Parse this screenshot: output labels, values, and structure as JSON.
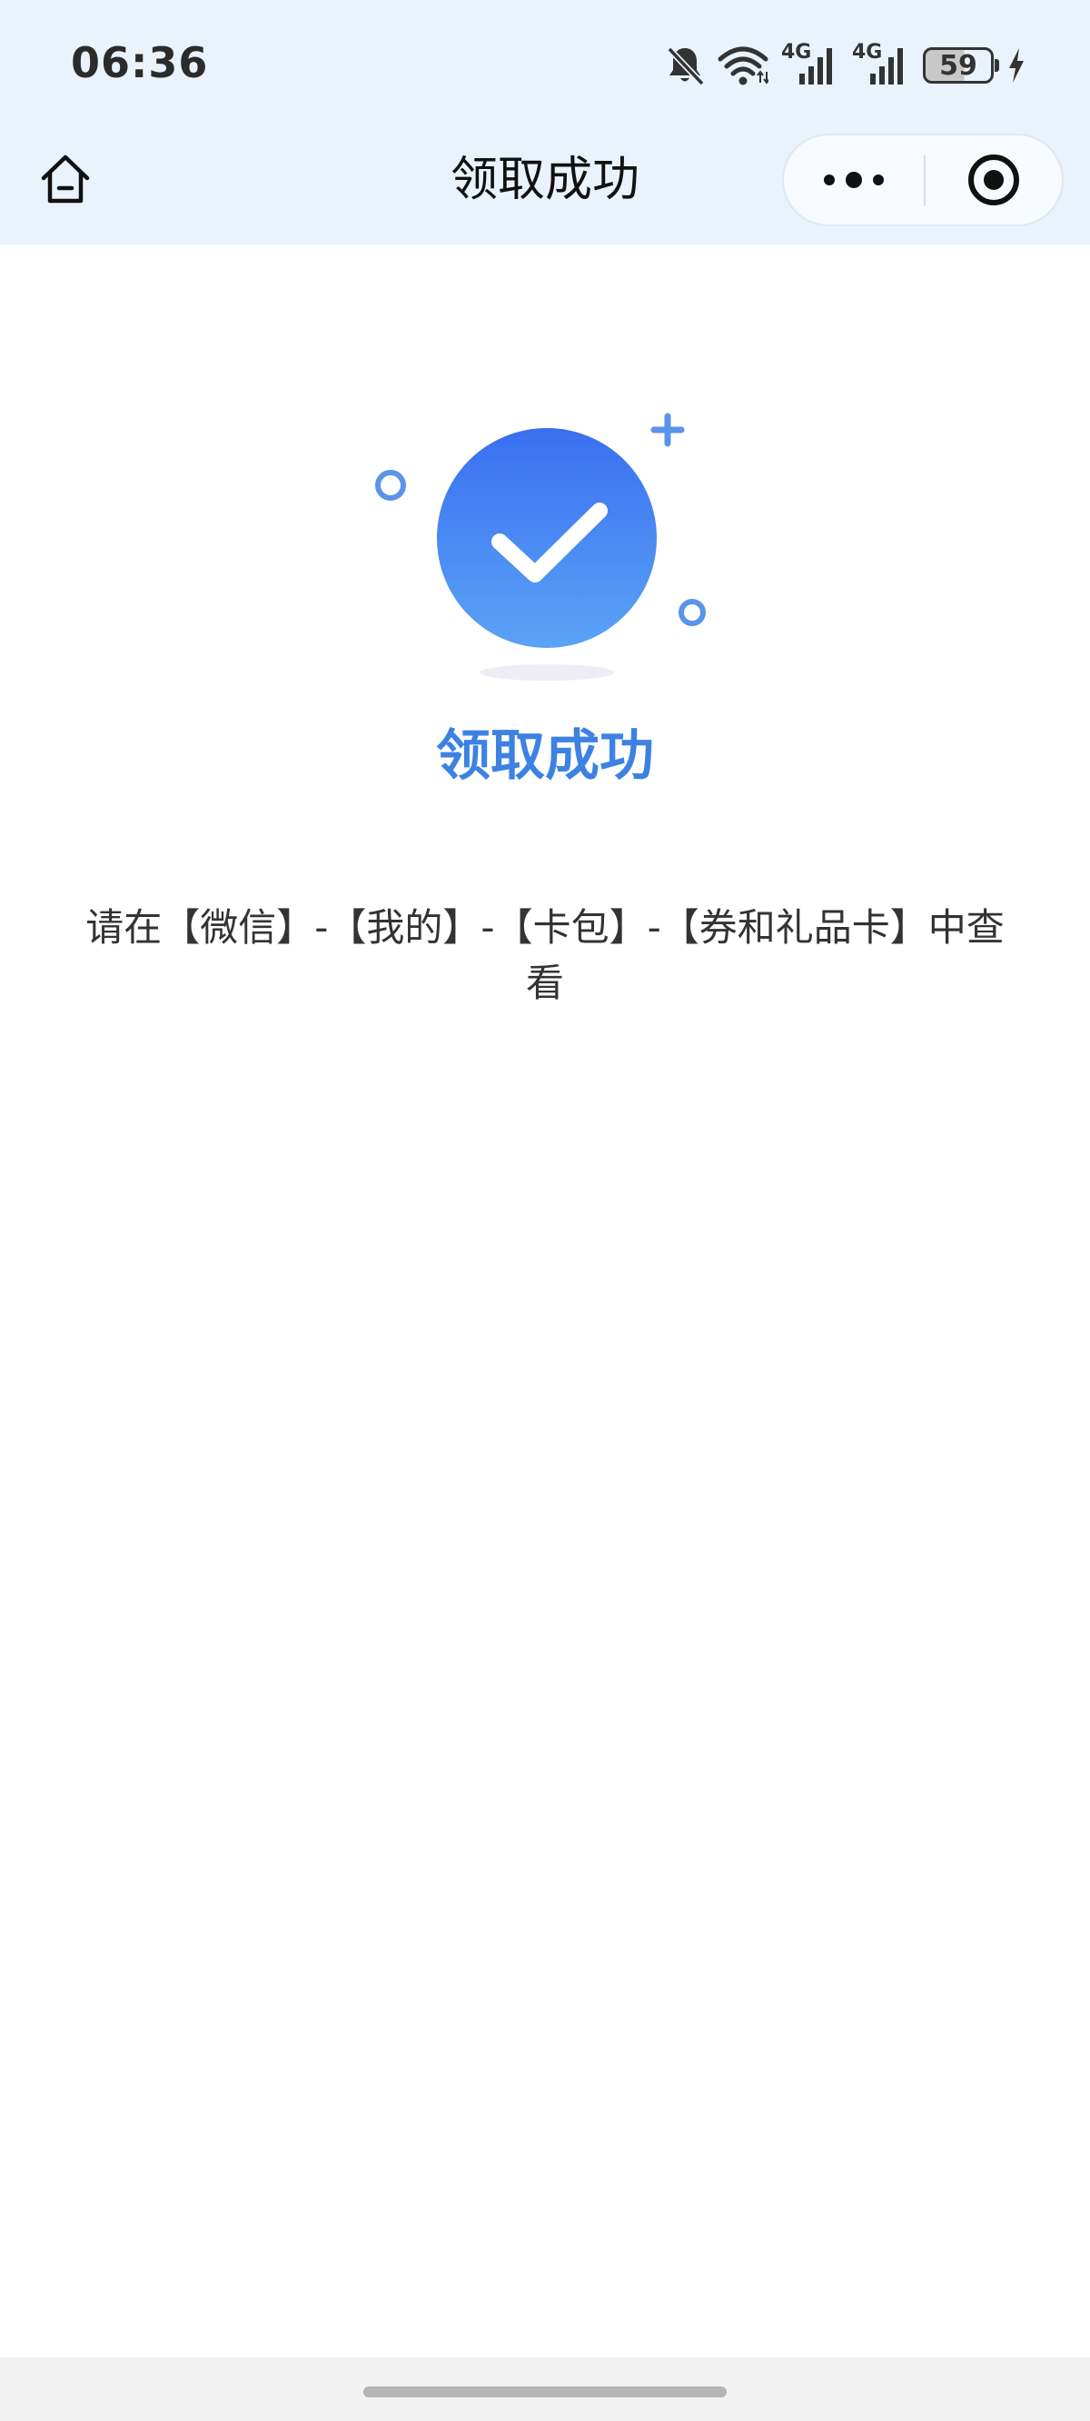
{
  "status_bar": {
    "time": "06:36",
    "network_1": "4G",
    "network_2": "4G",
    "battery_level": "59",
    "battery_fill": 0.59,
    "icons": [
      "bell-off-icon",
      "wifi-icon",
      "signal-icon",
      "signal-icon",
      "battery-icon",
      "charging-icon"
    ]
  },
  "nav": {
    "title": "领取成功",
    "home_icon": "home-icon",
    "more_icon": "more-icon",
    "close_icon": "target-icon"
  },
  "result": {
    "title": "领取成功",
    "message": "请在【微信】-【我的】-【卡包】-【券和礼品卡】中查看",
    "icon": "check-circle-icon"
  },
  "colors": {
    "accent": "#3d82e3",
    "header_bg": "#eaf3fb",
    "circle_top": "#3a6ff0",
    "circle_bottom": "#5aa0f5"
  }
}
